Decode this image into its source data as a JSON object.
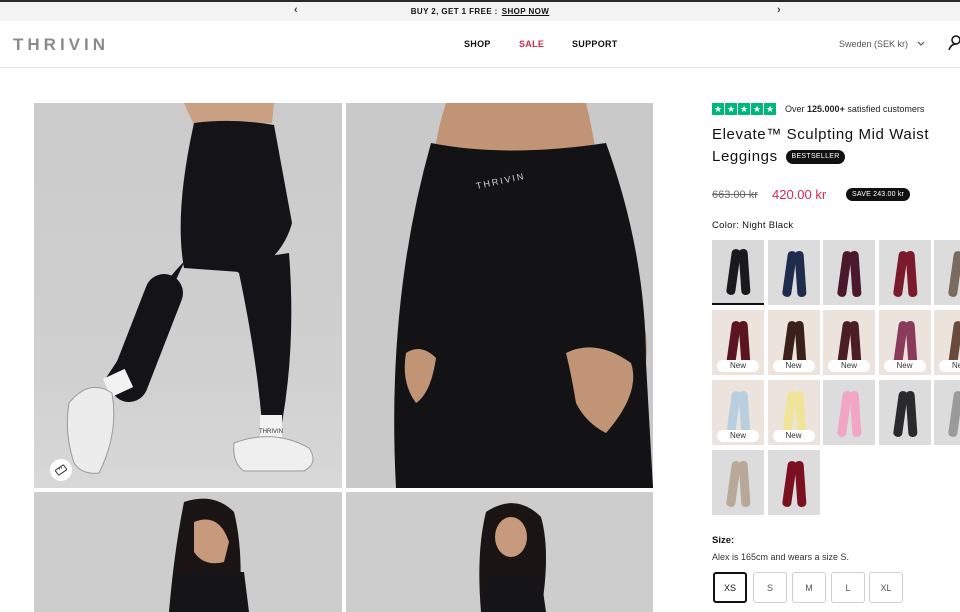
{
  "announcement": {
    "text": "BUY 2, GET 1 FREE :",
    "link": "SHOP NOW"
  },
  "header": {
    "logo": "THRIVIN",
    "nav": {
      "shop": "SHOP",
      "sale": "SALE",
      "support": "SUPPORT"
    },
    "region": "Sweden (SEK kr)"
  },
  "gallery": {
    "brand_on_leggings": "THRIVIN"
  },
  "product": {
    "rating_text_prefix": "Over",
    "rating_count": "125.000+",
    "rating_text_suffix": "satisfied customers",
    "title": "Elevate™ Sculpting Mid Waist Leggings",
    "badge": "BESTSELLER",
    "old_price": "663.00 kr",
    "price": "420.00 kr",
    "save": "SAVE 243.00 kr",
    "color_label": "Color: Night Black"
  },
  "swatches": [
    {
      "color": "#1a1a1e",
      "bg": "#d9d9d9",
      "new": false
    },
    {
      "color": "#1f2c4d",
      "bg": "#dcdcdc",
      "new": false
    },
    {
      "color": "#4a1a2c",
      "bg": "#dcdcdc",
      "new": false
    },
    {
      "color": "#7a1a2a",
      "bg": "#dcdcdc",
      "new": false
    },
    {
      "color": "#7a6b60",
      "bg": "#dcdcdc",
      "new": false
    },
    {
      "color": "#5a1520",
      "bg": "#ece4dc",
      "new": true
    },
    {
      "color": "#3a2018",
      "bg": "#ece4dc",
      "new": true
    },
    {
      "color": "#4a1e22",
      "bg": "#ece4dc",
      "new": true
    },
    {
      "color": "#8a3a5a",
      "bg": "#ece4dc",
      "new": true
    },
    {
      "color": "#6a4a3a",
      "bg": "#ece4dc",
      "new": true
    },
    {
      "color": "#b9cfe0",
      "bg": "#ece4dc",
      "new": true
    },
    {
      "color": "#f0e39a",
      "bg": "#ece4dc",
      "new": true
    },
    {
      "color": "#f2a6c6",
      "bg": "#dcdcdc",
      "new": false
    },
    {
      "color": "#2a2a2c",
      "bg": "#dcdcdc",
      "new": false
    },
    {
      "color": "#9a9a9a",
      "bg": "#dcdcdc",
      "new": false
    },
    {
      "color": "#b8a898",
      "bg": "#dcdcdc",
      "new": false
    },
    {
      "color": "#7a1020",
      "bg": "#dcdcdc",
      "new": false
    }
  ],
  "swatch_new_label": "New",
  "size": {
    "label": "Size:",
    "note": "Alex is 165cm and wears a size S.",
    "options": [
      "XS",
      "S",
      "M",
      "L",
      "XL"
    ],
    "selected": "XS"
  },
  "colors": {
    "accent_red": "#d12a4d",
    "trustpilot_green": "#00b67a"
  }
}
